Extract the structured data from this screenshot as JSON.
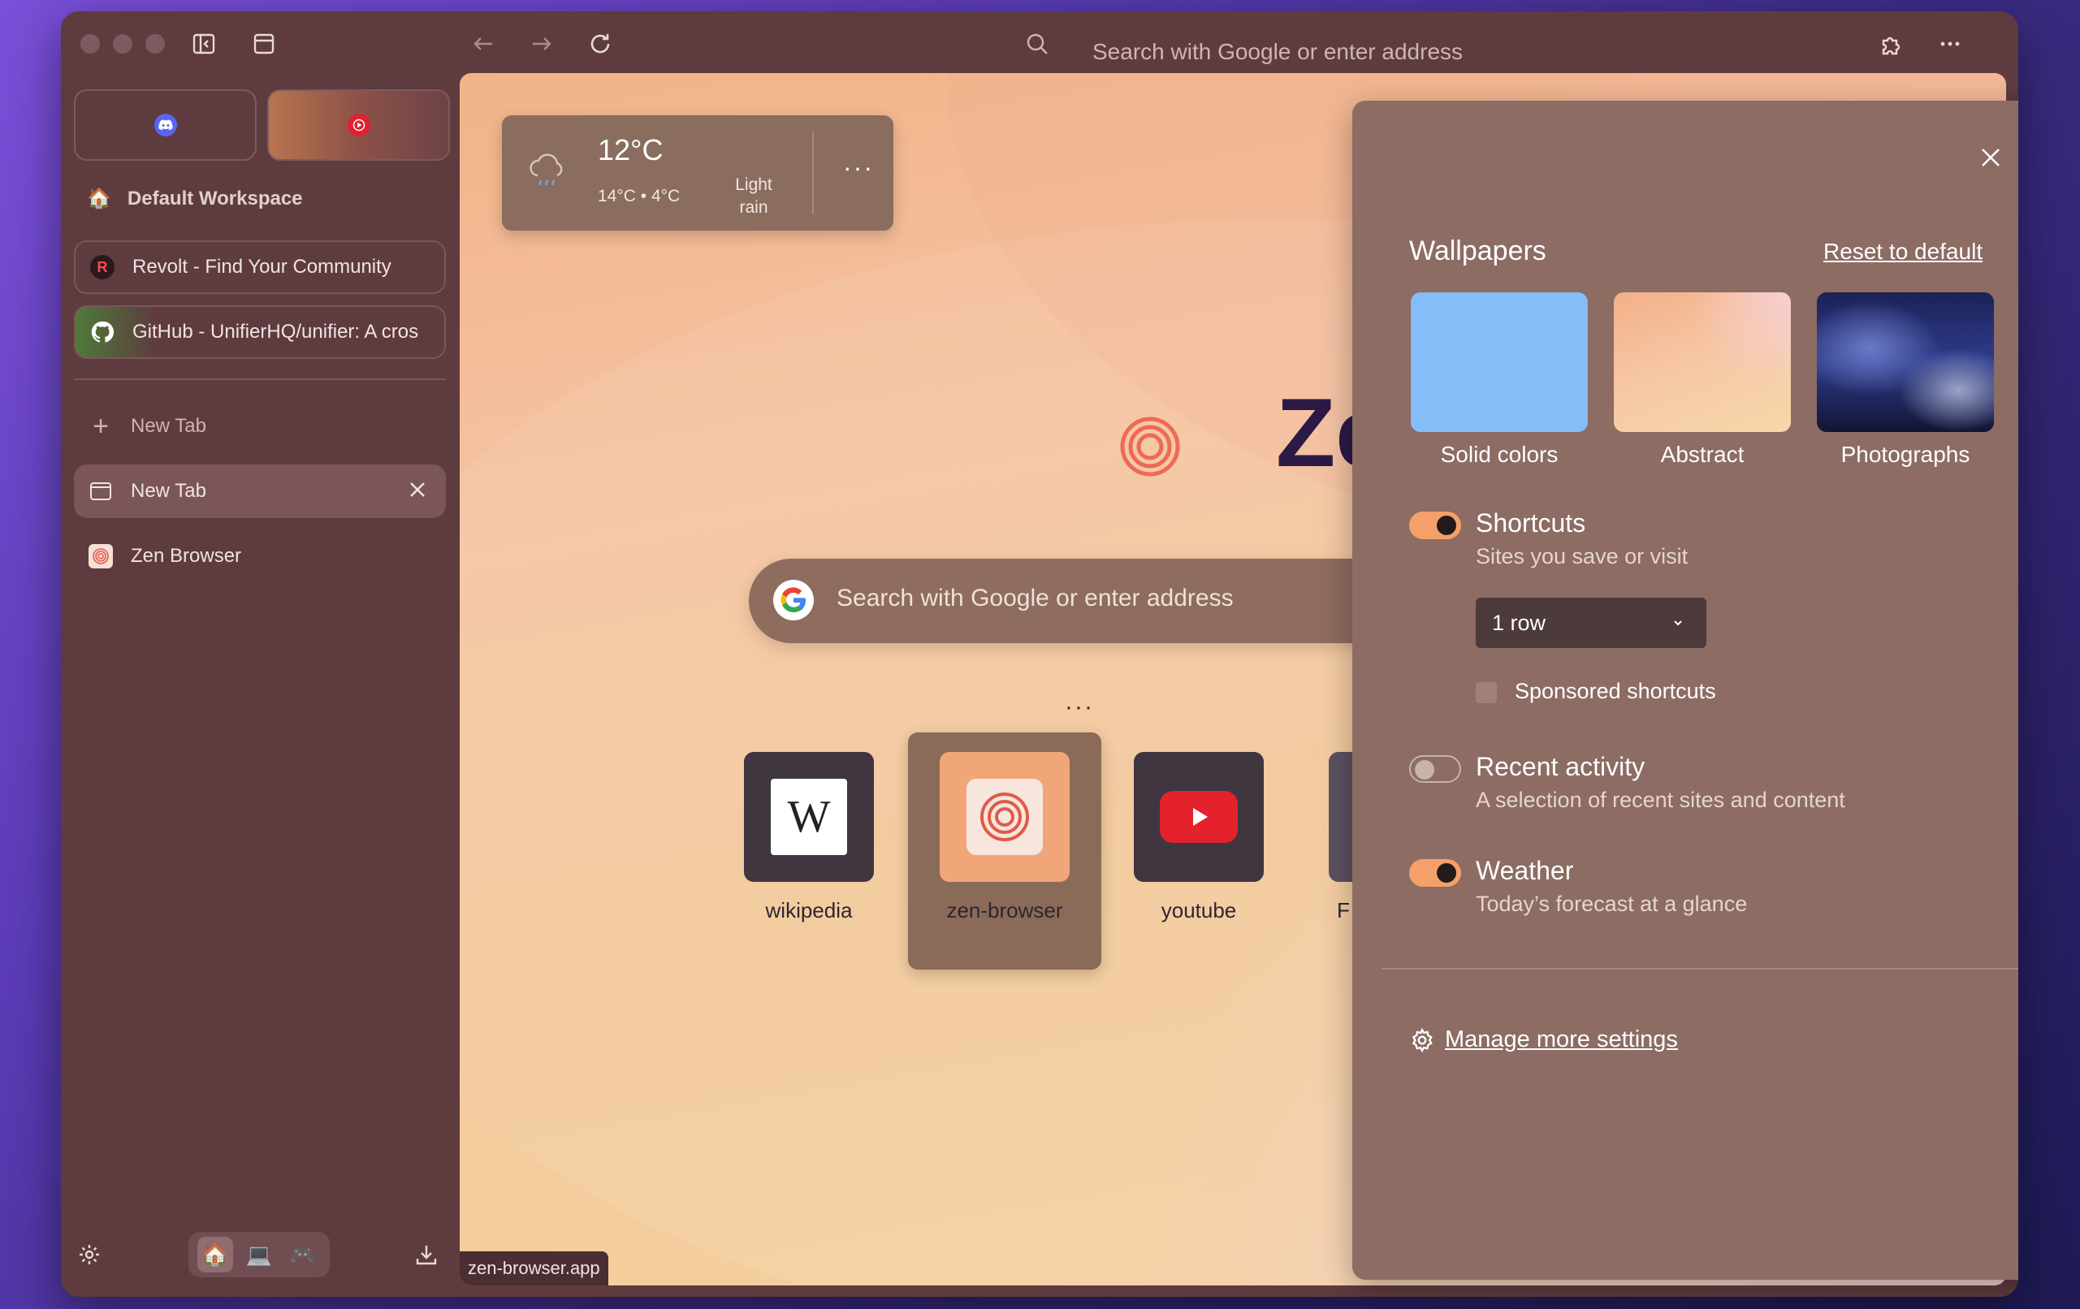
{
  "toolbar": {
    "url_placeholder": "Search with Google or enter address"
  },
  "sidebar": {
    "pinned": [
      {
        "name": "Discord",
        "icon": "discord-icon"
      },
      {
        "name": "YouTube Music",
        "icon": "youtube-music-icon"
      }
    ],
    "workspace": "Default Workspace",
    "tabs": [
      {
        "label": "Revolt - Find Your Community"
      },
      {
        "label": "GitHub - UnifierHQ/unifier: A cros"
      },
      {
        "label": "New Tab"
      },
      {
        "label": "New Tab"
      },
      {
        "label": "Zen Browser"
      }
    ]
  },
  "weather": {
    "temp": "12°C",
    "range": "14°C • 4°C",
    "desc_line1": "Light",
    "desc_line2": "rain"
  },
  "newtab": {
    "logo_text": "Ze",
    "search_placeholder": "Search with Google or enter address",
    "shortcuts": [
      {
        "label": "wikipedia"
      },
      {
        "label": "zen-browser"
      },
      {
        "label": "youtube"
      },
      {
        "label": "F"
      }
    ]
  },
  "status_url": "zen-browser.app",
  "panel": {
    "wallpapers_title": "Wallpapers",
    "reset_label": "Reset to default",
    "wallpapers": [
      {
        "label": "Solid colors"
      },
      {
        "label": "Abstract"
      },
      {
        "label": "Photographs"
      }
    ],
    "shortcuts": {
      "title": "Shortcuts",
      "sub": "Sites you save or visit",
      "enabled": true
    },
    "rows_select": "1 row",
    "sponsored_label": "Sponsored shortcuts",
    "recent": {
      "title": "Recent activity",
      "sub": "A selection of recent sites and content",
      "enabled": false
    },
    "weather": {
      "title": "Weather",
      "sub": "Today’s forecast at a glance",
      "enabled": true
    },
    "manage_label": "Manage more settings"
  },
  "colors": {
    "accent": "#f5a06a",
    "window_bg": "#5e3b3f",
    "panel_bg": "#8c6c63"
  }
}
